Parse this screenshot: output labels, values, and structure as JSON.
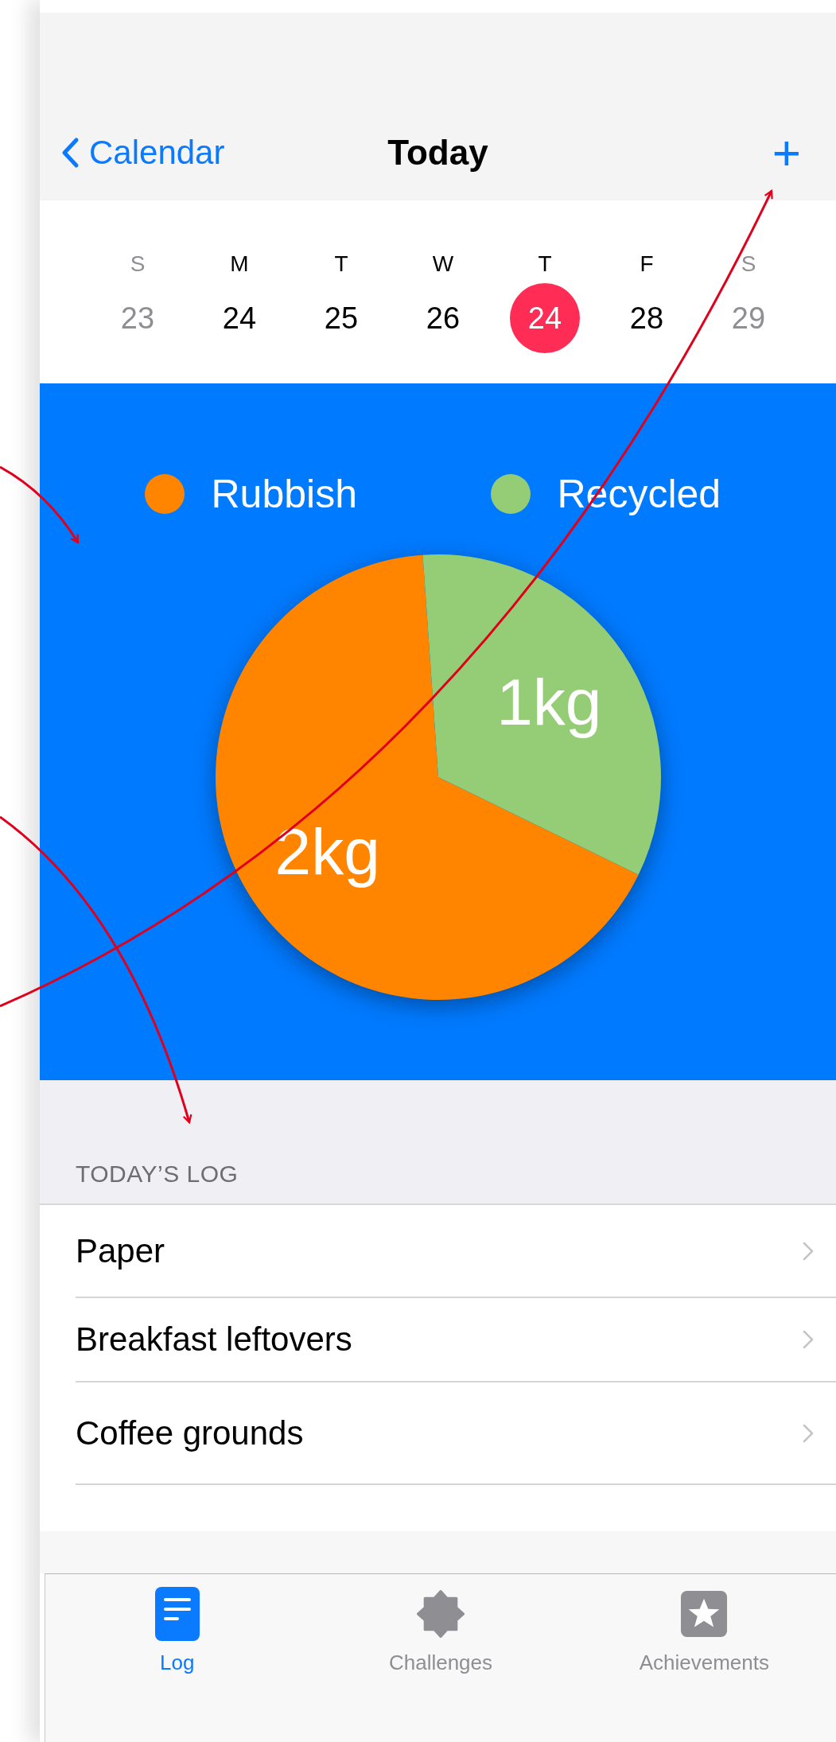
{
  "nav": {
    "back": "Calendar",
    "title": "Today",
    "add": "+"
  },
  "week": [
    {
      "letter": "S",
      "date": "23",
      "selected": false,
      "muted": true
    },
    {
      "letter": "M",
      "date": "24",
      "selected": false,
      "muted": false
    },
    {
      "letter": "T",
      "date": "25",
      "selected": false,
      "muted": false
    },
    {
      "letter": "W",
      "date": "26",
      "selected": false,
      "muted": false
    },
    {
      "letter": "T",
      "date": "24",
      "selected": true,
      "muted": false
    },
    {
      "letter": "F",
      "date": "28",
      "selected": false,
      "muted": false
    },
    {
      "letter": "S",
      "date": "29",
      "selected": false,
      "muted": true
    }
  ],
  "chart": {
    "legend": [
      {
        "color": "#ff8500"
      },
      {
        "color": "#94cd76"
      }
    ],
    "chart_data": {
      "type": "pie",
      "categories": [
        "Rubbish",
        "Recycled"
      ],
      "values": [
        2,
        1
      ],
      "value_labels": [
        "2kg",
        "1kg"
      ]
    }
  },
  "log": {
    "header": "TODAY’S LOG",
    "items": [
      {
        "label": "Paper"
      },
      {
        "label": "Breakfast leftovers"
      },
      {
        "label": "Coffee grounds"
      }
    ]
  },
  "tabs": [
    {
      "label": "Log",
      "kind": "document",
      "selected": true
    },
    {
      "label": "Challenges",
      "kind": "badge",
      "selected": false
    },
    {
      "label": "Achievements",
      "kind": "star",
      "selected": false
    }
  ]
}
